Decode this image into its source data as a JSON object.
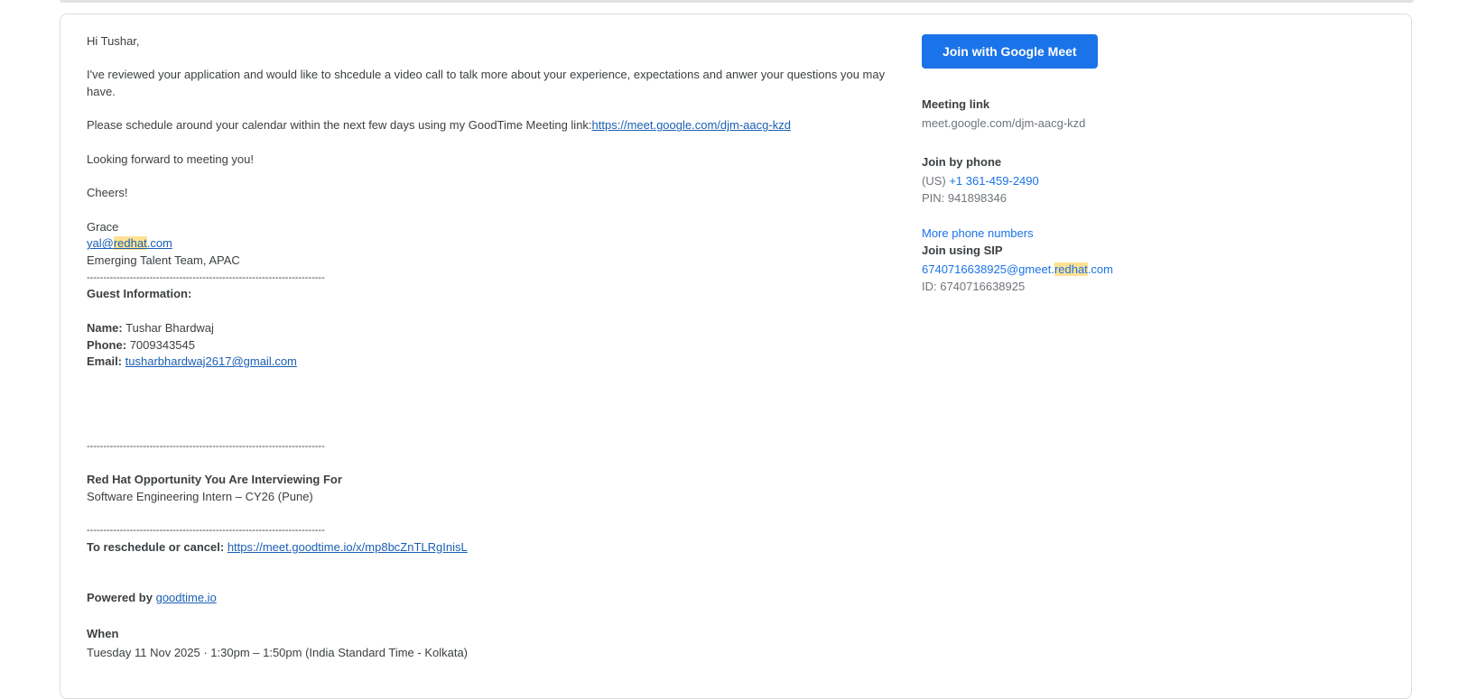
{
  "email": {
    "greeting": "Hi Tushar,",
    "intro": "I've reviewed your application and would like to shcedule a video call to talk more about your experience, expectations and anwer your questions you may have.",
    "schedule_text": "Please schedule around your calendar within the next few days using my GoodTime Meeting link:",
    "schedule_link": "https://meet.google.com/djm-aacg-kzd",
    "looking_forward": "Looking forward to meeting you!",
    "cheers": "Cheers!",
    "signature_name": "Grace",
    "sig_email_pre": "yal@",
    "sig_email_hl": "redhat",
    "sig_email_post": ".com",
    "sig_team": "Emerging Talent Team, APAC",
    "divider": "------------------------------------------------------------------------",
    "guest_info_heading": "Guest Information:",
    "name_label": "Name:",
    "name_value": "Tushar Bhardwaj",
    "phone_label": "Phone:",
    "phone_value": "7009343545",
    "email_label": "Email:",
    "email_value": "tusharbhardwaj2617@gmail.com",
    "opportunity_heading": "Red Hat Opportunity You Are Interviewing For",
    "opportunity_value": "Software Engineering Intern – CY26 (Pune)",
    "reschedule_label": "To reschedule or cancel:",
    "reschedule_link": "https://meet.goodtime.io/x/mp8bcZnTLRgInisL",
    "powered_label": "Powered by",
    "powered_link": "goodtime.io",
    "when_label": "When",
    "when_value": "Tuesday 11 Nov 2025 · 1:30pm – 1:50pm (India Standard Time - Kolkata)"
  },
  "meet": {
    "join_button": "Join with Google Meet",
    "link_label": "Meeting link",
    "link_value": "meet.google.com/djm-aacg-kzd",
    "phone_label": "Join by phone",
    "phone_region": "(US)",
    "phone_number": "+1 361-459-2490",
    "pin": "PIN: 941898346",
    "more_numbers": "More phone numbers",
    "sip_label": "Join using SIP",
    "sip_pre": "6740716638925@gmeet.",
    "sip_hl": "redhat",
    "sip_post": ".com",
    "sip_id": "ID: 6740716638925"
  },
  "colors": {
    "button": "#1a73e8",
    "highlight": "#fde293",
    "link": "#1a5fb4"
  }
}
